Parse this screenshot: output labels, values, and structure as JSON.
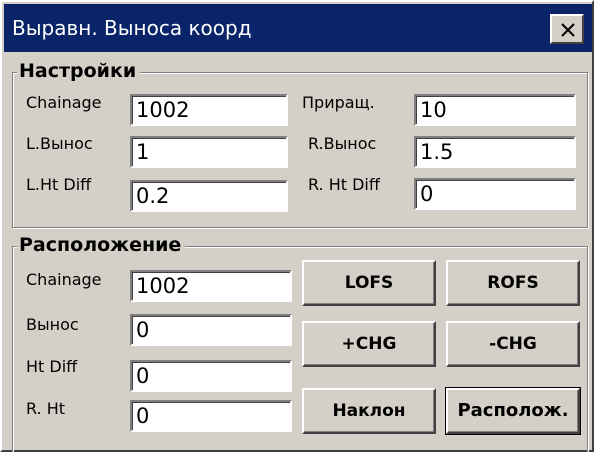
{
  "window": {
    "title": "Выравн. Выноса коорд",
    "close_label": "×"
  },
  "settings": {
    "group_title": "Настройки",
    "chainage_label": "Chainage",
    "chainage_value": "1002",
    "increment_label": "Приращ.",
    "increment_value": "10",
    "l_offset_label": "L.Вынос",
    "l_offset_value": "1",
    "r_offset_label": "R.Вынос",
    "r_offset_value": "1.5",
    "l_ht_diff_label": "L.Ht Diff",
    "l_ht_diff_value": "0.2",
    "r_ht_diff_label": "R. Ht Diff",
    "r_ht_diff_value": "0"
  },
  "location": {
    "group_title": "Расположение",
    "chainage_label": "Chainage",
    "chainage_value": "1002",
    "offset_label": "Вынос",
    "offset_value": "0",
    "ht_diff_label": "Ht Diff",
    "ht_diff_value": "0",
    "r_ht_label": "R. Ht",
    "r_ht_value": "0"
  },
  "buttons": {
    "lofs": "LOFS",
    "rofs": "ROFS",
    "plus_chg": "+CHG",
    "minus_chg": "-CHG",
    "slope": "Наклон",
    "locate": "Располож."
  },
  "colors": {
    "titlebar": "#0a246a",
    "face": "#d4d0c8"
  }
}
